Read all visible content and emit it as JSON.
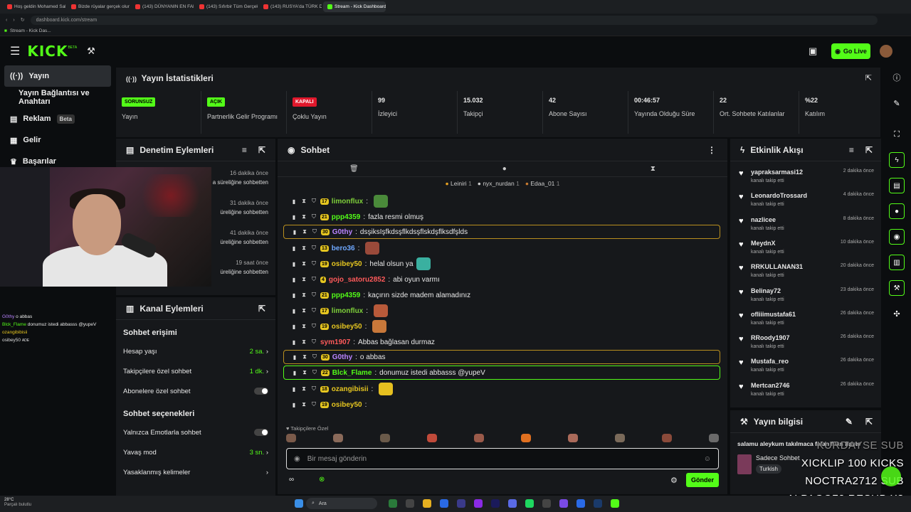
{
  "browser": {
    "tabs": [
      {
        "label": "Hoş geldin Mohamed Salah"
      },
      {
        "label": "Bizde rüyalar gerçek olur"
      },
      {
        "label": "(143) DÜNYANIN EN FAKİR"
      },
      {
        "label": "(143) Sıfırbir Tüm Gerçekler"
      },
      {
        "label": "(143) RUSYA'da TÜRK DİY"
      },
      {
        "label": "Stream - Kick Dashboard"
      }
    ],
    "url": "dashboard.kick.com/stream",
    "bookmark": "Stream - Kick Das..."
  },
  "header": {
    "logo": "KICK",
    "logo_badge": "BETA",
    "go_live": "Go Live"
  },
  "sidebar": {
    "items": [
      {
        "label": "Yayın"
      },
      {
        "label": "Yayın Bağlantısı ve Anahtarı"
      },
      {
        "label": "Reklam",
        "badge": "Beta"
      },
      {
        "label": "Gelir"
      },
      {
        "label": "Başarılar"
      }
    ]
  },
  "stats": {
    "title": "Yayın İstatistikleri",
    "cards": [
      {
        "badge": "SORUNSUZ",
        "label": "Yayın"
      },
      {
        "badge": "AÇIK",
        "label": "Partnerlik Gelir Programı"
      },
      {
        "badge": "KAPALI",
        "label": "Çoklu Yayın"
      },
      {
        "value": "99",
        "label": "İzleyici"
      },
      {
        "value": "15.032",
        "label": "Takipçi"
      },
      {
        "value": "42",
        "label": "Abone Sayısı"
      },
      {
        "value": "00:46:57",
        "label": "Yayında Olduğu Süre"
      },
      {
        "value": "22",
        "label": "Ort. Sohbete Katılanlar"
      },
      {
        "value": "%22",
        "label": "Katılım"
      }
    ]
  },
  "mod": {
    "title": "Denetim Eylemleri",
    "items": [
      {
        "time": "16 dakika önce",
        "text": "a süreliğine sohbetten"
      },
      {
        "time": "31 dakika önce",
        "text": "üreliğine sohbetten"
      },
      {
        "time": "41 dakika önce",
        "text": "üreliğine sohbetten"
      },
      {
        "time": "19 saat önce",
        "text": "üreliğine sohbetten"
      }
    ]
  },
  "channel": {
    "title": "Kanal Eylemleri",
    "sec1": "Sohbet erişimi",
    "sec2": "Sohbet seçenekleri",
    "rows": [
      {
        "label": "Hesap yaşı",
        "value": "2 sa."
      },
      {
        "label": "Takipçilere özel sohbet",
        "value": "1 dk."
      },
      {
        "label": "Abonelere özel sohbet",
        "value": ""
      },
      {
        "label": "Yalnızca Emotlarla sohbet",
        "value": ""
      },
      {
        "label": "Yavaş mod",
        "value": "3 sn."
      },
      {
        "label": "Yasaklanmış kelimeler",
        "value": ""
      }
    ]
  },
  "overlay_chat": [
    {
      "user": "G0thy",
      "text": "o abbas"
    },
    {
      "user": "Blck_Flame",
      "text": "donumuz istedi abbasss @yupeV"
    },
    {
      "user": "ozangibibisii",
      "text": ""
    },
    {
      "user": "osibey50",
      "text": "ADE"
    }
  ],
  "chat": {
    "title": "Sohbet",
    "pinned": [
      {
        "name": "Leiniri",
        "count": "1"
      },
      {
        "name": "nyx_nurdan",
        "count": "1"
      },
      {
        "name": "Edaa_01",
        "count": "1"
      }
    ],
    "messages": [
      {
        "lvl": "17",
        "user": "limonflux",
        "color": "#7ecf3a",
        "text": "",
        "emote": "#4a8a3a"
      },
      {
        "lvl": "21",
        "user": "ppp4359",
        "color": "#53fc18",
        "text": "fazla resmi olmuş"
      },
      {
        "lvl": "30",
        "user": "G0thy",
        "color": "#b983ff",
        "text": "dsşiksIşfkdsşflkdsşflskdşflksdfşlds",
        "hl": "gold"
      },
      {
        "lvl": "13",
        "user": "bero36",
        "color": "#6fa8ff",
        "text": "",
        "emote": "#9a4a3a"
      },
      {
        "lvl": "19",
        "user": "osibey50",
        "color": "#e6c620",
        "text": "helal olsun ya",
        "emote": "#3ab0a0"
      },
      {
        "lvl": "4",
        "user": "gojo_satoru2852",
        "color": "#ff5a5a",
        "text": "abi oyun varmı"
      },
      {
        "lvl": "21",
        "user": "ppp4359",
        "color": "#53fc18",
        "text": "kaçırın sizde madem alamadınız"
      },
      {
        "lvl": "17",
        "user": "limonflux",
        "color": "#7ecf3a",
        "text": "",
        "emote": "#b85a3a"
      },
      {
        "lvl": "19",
        "user": "osibey50",
        "color": "#e6c620",
        "text": "",
        "emote": "#c8783a"
      },
      {
        "lvl": "",
        "user": "sym1907",
        "color": "#ff5a5a",
        "text": "Abbas bağlasan durmaz"
      },
      {
        "lvl": "30",
        "user": "G0thy",
        "color": "#b983ff",
        "text": "o abbas",
        "hl": "gold"
      },
      {
        "lvl": "22",
        "user": "Blck_Flame",
        "color": "#53fc18",
        "text": "donumuz istedi abbasss @yupeV",
        "hl": "green"
      },
      {
        "lvl": "18",
        "user": "ozangibisii",
        "color": "#e6c620",
        "text": "",
        "emote": "#e6c020"
      },
      {
        "lvl": "19",
        "user": "osibey50",
        "color": "#e6c620",
        "text": ""
      }
    ],
    "followers_label": "Takipçilere Özel",
    "input_placeholder": "Bir mesaj gönderin",
    "send": "Gönder"
  },
  "activity": {
    "title": "Etkinlik Akışı",
    "items": [
      {
        "name": "yapraksarmasi12",
        "sub": "kanalı takip etti",
        "time": "2 dakika önce"
      },
      {
        "name": "LeonardoTrossard",
        "sub": "kanalı takip etti",
        "time": "4 dakika önce"
      },
      {
        "name": "nazlicee",
        "sub": "kanalı takip etti",
        "time": "8 dakika önce"
      },
      {
        "name": "MeydnX",
        "sub": "kanalı takip etti",
        "time": "10 dakika önce"
      },
      {
        "name": "RRKULLANAN31",
        "sub": "kanalı takip etti",
        "time": "20 dakika önce"
      },
      {
        "name": "Belinay72",
        "sub": "kanalı takip etti",
        "time": "23 dakika önce"
      },
      {
        "name": "ofliiimustafa61",
        "sub": "kanalı takip etti",
        "time": "26 dakika önce"
      },
      {
        "name": "RRoody1907",
        "sub": "kanalı takip etti",
        "time": "26 dakika önce"
      },
      {
        "name": "Mustafa_reo",
        "sub": "kanalı takip etti",
        "time": "26 dakika önce"
      },
      {
        "name": "Mertcan2746",
        "sub": "kanalı takip etti",
        "time": "26 dakika önce"
      }
    ]
  },
  "info": {
    "title": "Yayın bilgisi",
    "stream_title": "salamu aleykum takılmaca falan filan flasts",
    "category": "Sadece Sohbet",
    "tag": "Turkish"
  },
  "stream_overlay": [
    "KURDAYSE SUB",
    "XICKLIP 100 KICKS",
    "NOCTRA2712 SUB",
    "ALPAGO72 RESUB X3"
  ],
  "taskbar": {
    "weather": "28°C",
    "weather_sub": "Parçalı bulutlu",
    "search": "Ara"
  }
}
